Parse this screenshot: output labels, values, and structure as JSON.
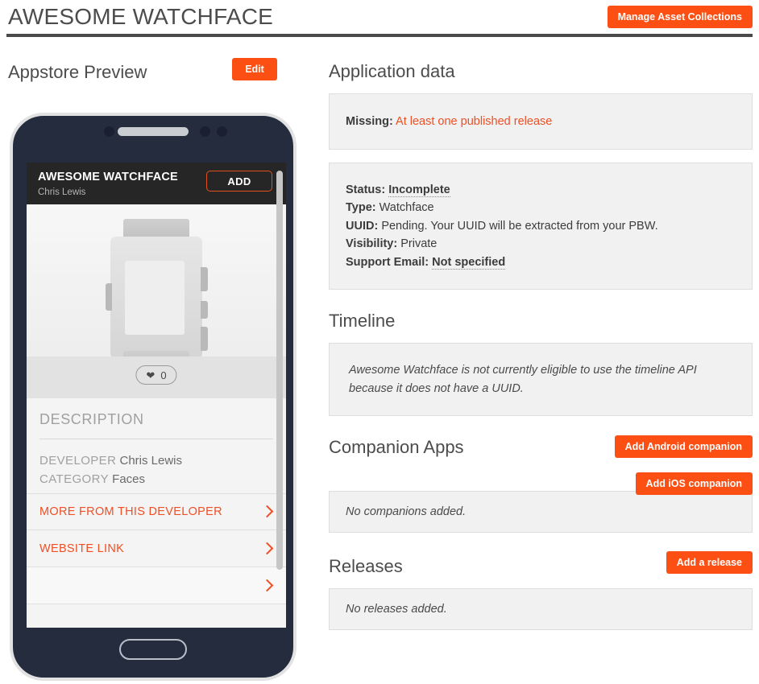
{
  "header": {
    "title": "AWESOME WATCHFACE",
    "manage_button": "Manage Asset Collections"
  },
  "preview": {
    "heading": "Appstore Preview",
    "edit_button": "Edit",
    "phone_app": {
      "app_title": "AWESOME WATCHFACE",
      "author": "Chris Lewis",
      "add_button": "ADD",
      "like_count": "0",
      "description_heading": "DESCRIPTION",
      "meta": [
        {
          "key": "DEVELOPER",
          "value": "Chris Lewis"
        },
        {
          "key": "CATEGORY",
          "value": "Faces"
        }
      ],
      "links": [
        {
          "label": "MORE FROM THIS DEVELOPER"
        },
        {
          "label": "WEBSITE LINK"
        }
      ]
    }
  },
  "application_data": {
    "heading": "Application data",
    "missing_label": "Missing:",
    "missing_value": "At least one published release",
    "fields": [
      {
        "label": "Status:",
        "value": "Incomplete",
        "style": "dotted-bold"
      },
      {
        "label": "Type:",
        "value": "Watchface",
        "style": "plain"
      },
      {
        "label": "UUID:",
        "value": "Pending. Your UUID will be extracted from your PBW.",
        "style": "plain"
      },
      {
        "label": "Visibility:",
        "value": "Private",
        "style": "plain"
      },
      {
        "label": "Support Email:",
        "value": "Not specified",
        "style": "dotted-bold"
      }
    ]
  },
  "timeline": {
    "heading": "Timeline",
    "message": "Awesome Watchface is not currently eligible to use the timeline API because it does not have a UUID."
  },
  "companion_apps": {
    "heading": "Companion Apps",
    "add_android_button": "Add Android companion",
    "add_ios_button": "Add iOS companion",
    "empty_message": "No companions added."
  },
  "releases": {
    "heading": "Releases",
    "add_release_button": "Add a release",
    "empty_message": "No releases added."
  },
  "colors": {
    "accent": "#fb4f14",
    "link": "#f04e23",
    "phone_body": "#242c3e",
    "panel_bg": "#f1f1f1",
    "heading": "#4c4c4c"
  }
}
